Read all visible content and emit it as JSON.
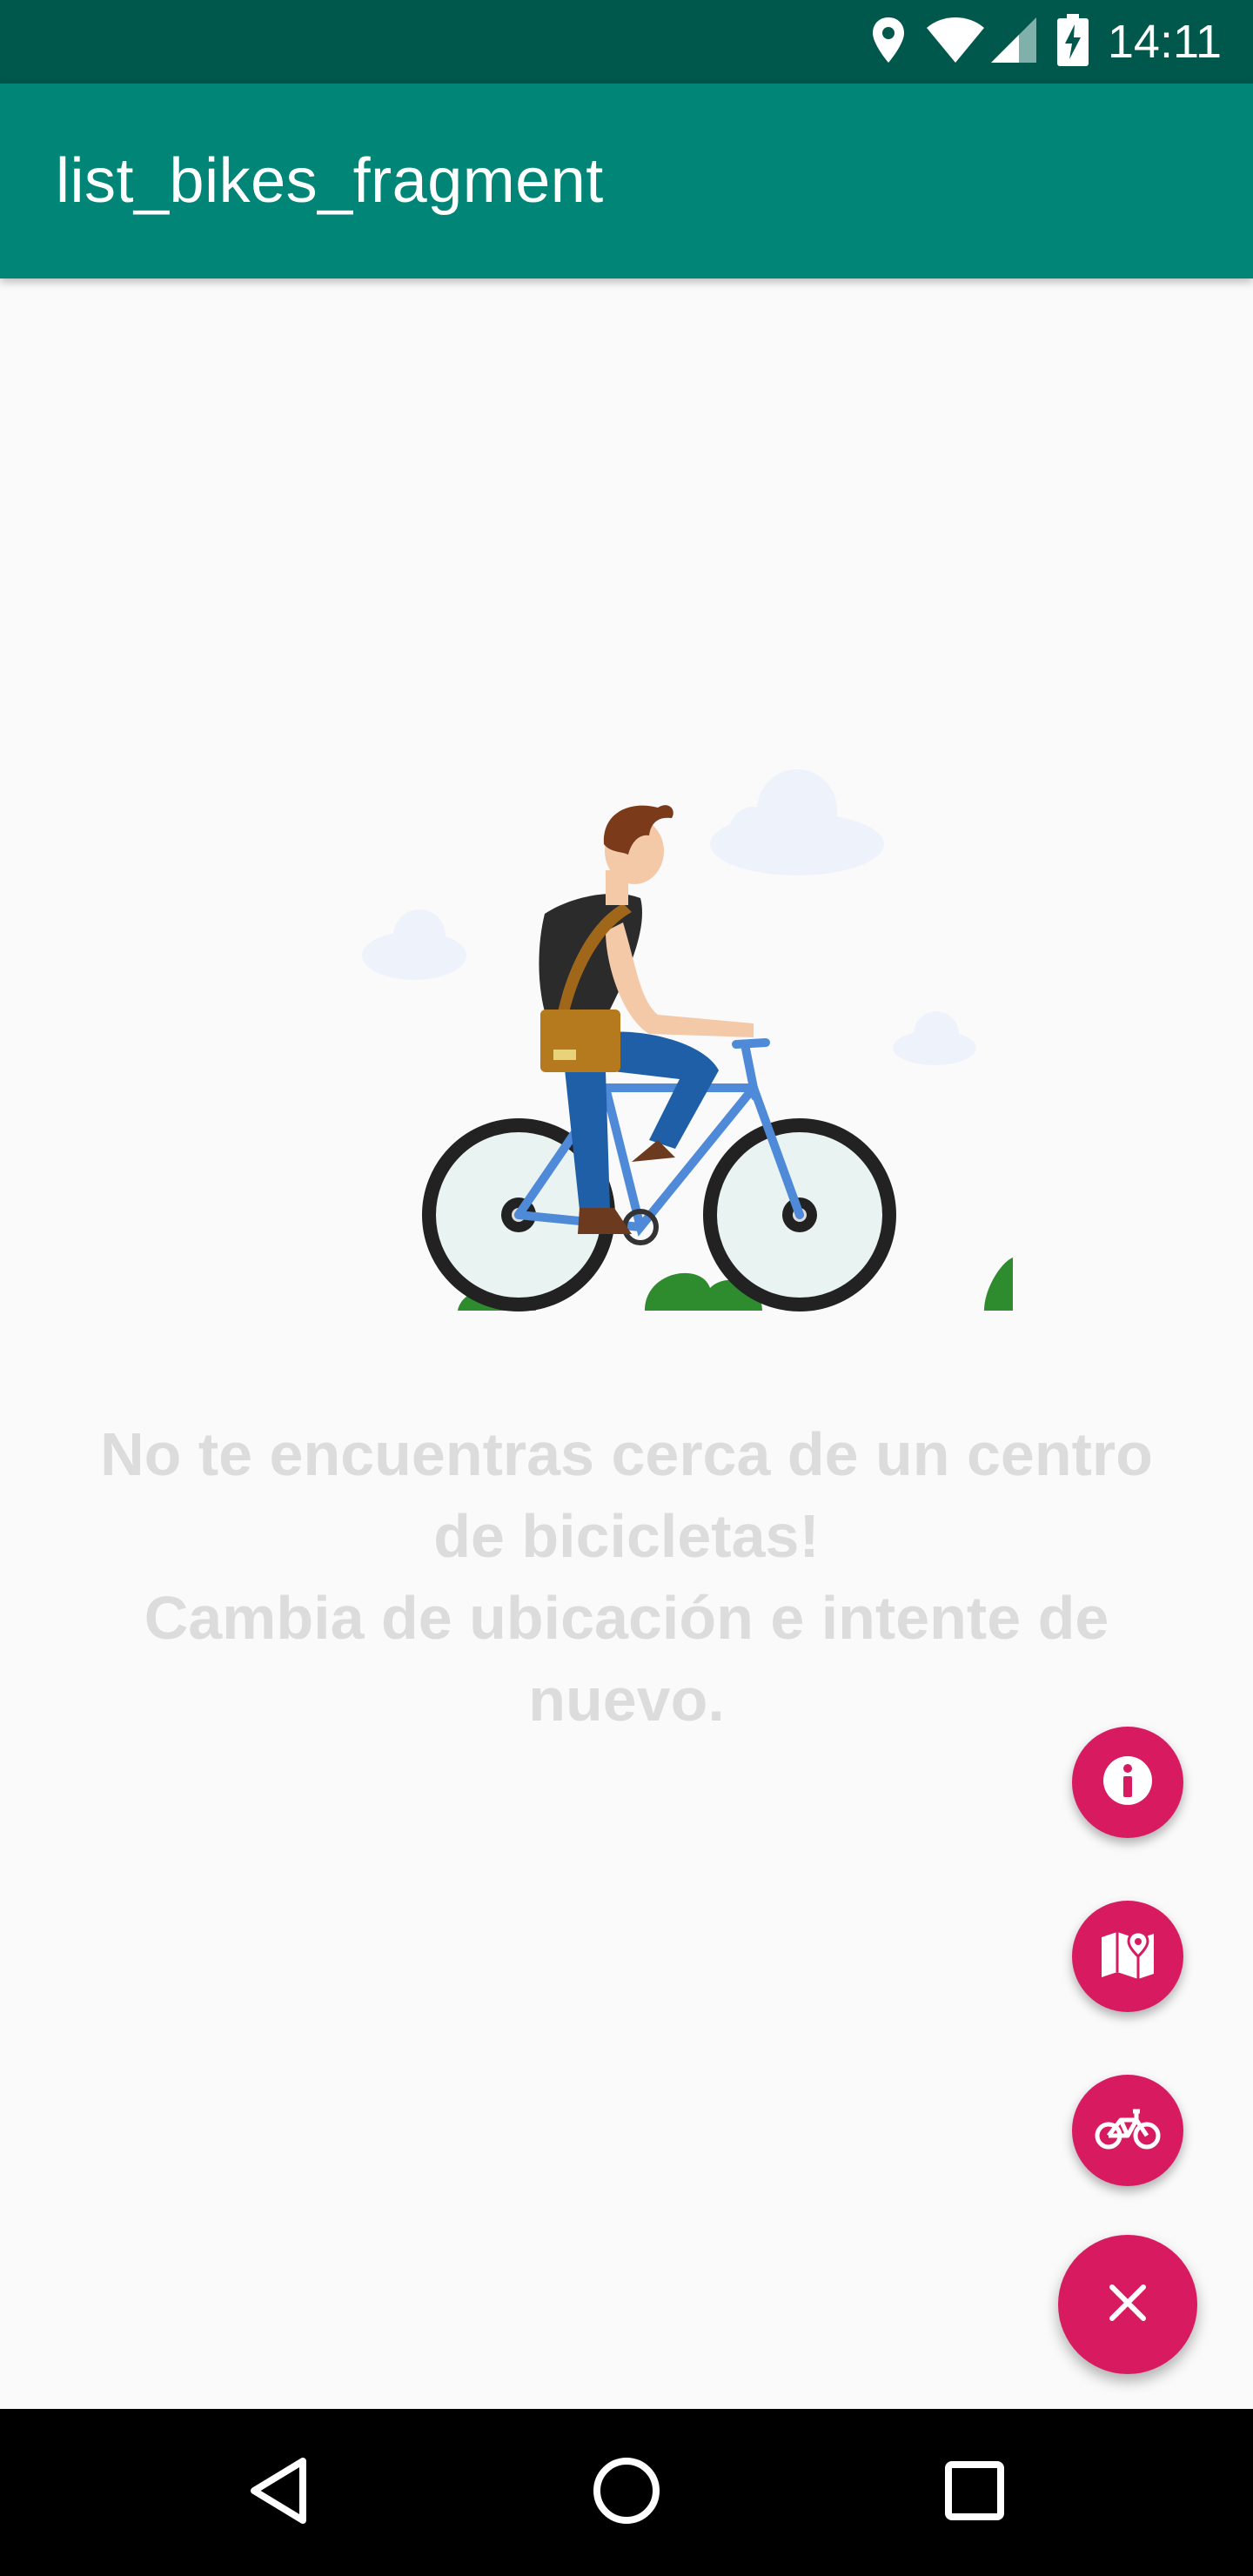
{
  "status_bar": {
    "time": "14:11",
    "icons": [
      "location-icon",
      "wifi-icon",
      "signal-icon",
      "battery-charging-icon"
    ]
  },
  "app_bar": {
    "title": "list_bikes_fragment"
  },
  "empty_state": {
    "illustration": "cyclist-illustration",
    "lines": [
      "No te encuentras cerca de un centro",
      "de bicicletas!",
      "Cambia de ubicación e intente de",
      "nuevo."
    ]
  },
  "fab_menu": {
    "items": [
      {
        "icon": "info-icon"
      },
      {
        "icon": "map-icon"
      },
      {
        "icon": "bike-icon"
      }
    ],
    "main_icon": "close-icon",
    "color": "#d81b60"
  },
  "nav_bar": {
    "buttons": [
      "back-icon",
      "home-icon",
      "recents-icon"
    ]
  },
  "colors": {
    "primary": "#008577",
    "primary_dark": "#00574b",
    "accent": "#d81b60",
    "background": "#fafafa"
  }
}
